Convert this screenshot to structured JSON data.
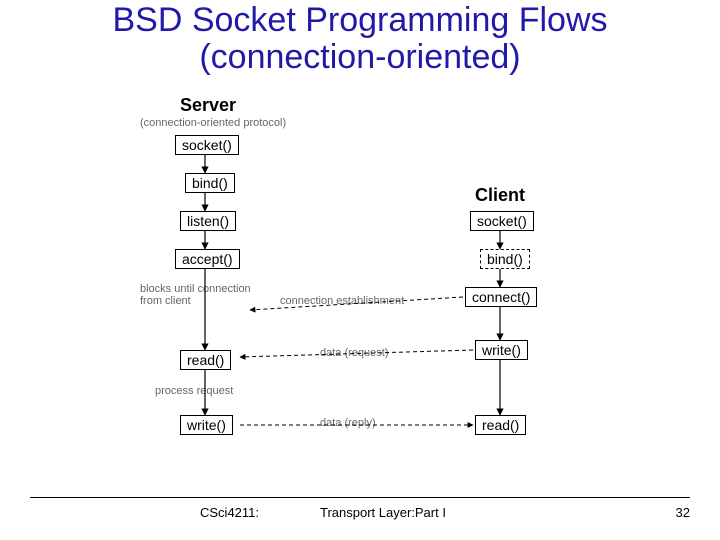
{
  "title_line1": "BSD Socket Programming Flows",
  "title_line2": "(connection-oriented)",
  "server": {
    "header": "Server",
    "subheader": "(connection-oriented protocol)",
    "steps": [
      "socket()",
      "bind()",
      "listen()",
      "accept()",
      "read()",
      "write()"
    ],
    "block_note": "blocks until connection\nfrom client",
    "process_note": "process request"
  },
  "client": {
    "header": "Client",
    "steps": [
      "socket()",
      "bind()",
      "connect()",
      "write()",
      "read()"
    ]
  },
  "edges": {
    "establish": "connection establishment",
    "request": "data (request)",
    "reply": "data (reply)"
  },
  "footer": {
    "left": "CSci4211:",
    "center": "Transport Layer:Part I",
    "page": "32"
  }
}
